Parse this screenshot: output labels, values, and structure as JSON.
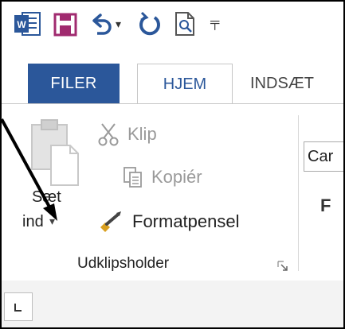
{
  "quick_access_toolbar": {
    "icons": [
      "word-logo-icon",
      "save-icon",
      "undo-icon",
      "dropdown-arrow-icon",
      "redo-icon",
      "print-preview-icon",
      "customize-toolbar-icon"
    ]
  },
  "tabs": {
    "file": "FILER",
    "home": "HJEM",
    "insert": "INDSÆT"
  },
  "clipboard_group": {
    "paste_label_line1": "Sæt",
    "paste_label_line2": "ind",
    "cut_label": "Klip",
    "copy_label": "Kopiér",
    "format_painter_label": "Formatpensel",
    "group_name": "Udklipsholder"
  },
  "font_group": {
    "font_name_partial": "Car",
    "bold_label": "F"
  },
  "colors": {
    "file_tab_bg": "#2b579a",
    "home_tab_text": "#2b579a",
    "word_blue": "#2b579a",
    "save_purple": "#a02a6f",
    "disabled_text": "#9a9a9a"
  }
}
